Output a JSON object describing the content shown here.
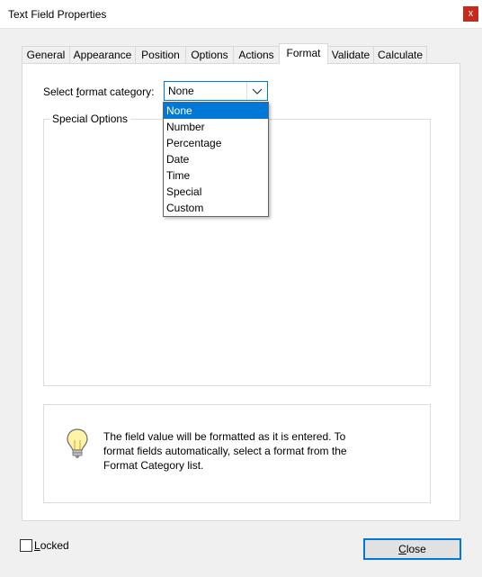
{
  "window": {
    "title": "Text Field Properties",
    "close_glyph": "x"
  },
  "tabs": [
    {
      "label": "General"
    },
    {
      "label": "Appearance"
    },
    {
      "label": "Position"
    },
    {
      "label": "Options"
    },
    {
      "label": "Actions"
    },
    {
      "label": "Format",
      "active": true
    },
    {
      "label": "Validate"
    },
    {
      "label": "Calculate"
    }
  ],
  "format": {
    "category_label_pre": "Select ",
    "category_label_accel": "f",
    "category_label_post": "ormat category:",
    "selected": "None",
    "options": [
      "None",
      "Number",
      "Percentage",
      "Date",
      "Time",
      "Special",
      "Custom"
    ]
  },
  "special_options": {
    "legend": "Special Options"
  },
  "info": {
    "icon": "lightbulb-icon",
    "text_line1": "The field value will be formatted as it is entered. To",
    "text_line2": "format fields automatically, select a format from the",
    "text_line3": "Format Category list."
  },
  "footer": {
    "locked_accel": "L",
    "locked_rest": "ocked",
    "locked_checked": false,
    "close_accel": "C",
    "close_rest": "lose"
  },
  "colors": {
    "accent": "#0078d7",
    "titlebar_close": "#c42b1c"
  }
}
